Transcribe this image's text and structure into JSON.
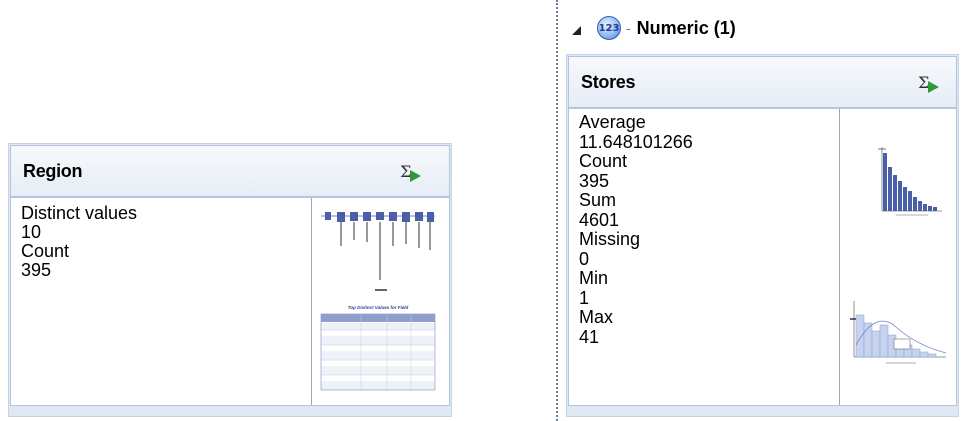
{
  "region_card": {
    "title": "Region",
    "stats": [
      {
        "label": "Distinct values",
        "value": "10"
      },
      {
        "label": "Count",
        "value": "395"
      }
    ],
    "thumb_chart_icon": "bar-chart-thumbnail-icon",
    "thumb_table_icon": "table-thumbnail-icon",
    "thumb_table_title": "Top Distinct Values for Field"
  },
  "numeric_section": {
    "label": "Numeric (1)",
    "icon": "numeric-123-icon",
    "collapse_icon": "expanded-triangle-icon"
  },
  "stores_card": {
    "title": "Stores",
    "stats": [
      {
        "label": "Average",
        "value": "11.648101266"
      },
      {
        "label": "Count",
        "value": "395"
      },
      {
        "label": "Sum",
        "value": "4601"
      },
      {
        "label": "Missing",
        "value": "0"
      },
      {
        "label": "Min",
        "value": "1"
      },
      {
        "label": "Max",
        "value": "41"
      }
    ],
    "thumb_bar_icon": "frequency-bar-thumbnail-icon",
    "thumb_hist_icon": "histogram-thumbnail-icon"
  },
  "colors": {
    "card_bg": "#dfe9f5",
    "card_border": "#b3c5dc",
    "bar_blue": "#4a5fa8",
    "sigma_green": "#2e9a3a"
  }
}
